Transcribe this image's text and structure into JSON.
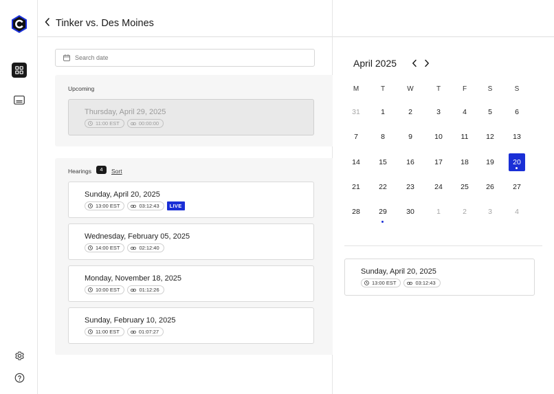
{
  "header": {
    "title": "Tinker vs. Des Moines"
  },
  "search": {
    "placeholder": "Search date"
  },
  "upcoming": {
    "label": "Upcoming",
    "card": {
      "date": "Thursday, April 29, 2025",
      "time": "11:00 EST",
      "duration": "00:00:00"
    }
  },
  "hearings": {
    "label": "Hearings",
    "count": "4",
    "sort_label": "Sort",
    "items": [
      {
        "date": "Sunday, April 20, 2025",
        "time": "13:00 EST",
        "duration": "03:12:43",
        "badge": "LIVE"
      },
      {
        "date": "Wednesday, February 05, 2025",
        "time": "14:00 EST",
        "duration": "02:12:40"
      },
      {
        "date": "Monday, November 18, 2025",
        "time": "10:00 EST",
        "duration": "01:12:26"
      },
      {
        "date": "Sunday, February 10, 2025",
        "time": "11:00 EST",
        "duration": "01:07:27"
      }
    ]
  },
  "calendar": {
    "month_label": "April 2025",
    "weekdays": [
      "M",
      "T",
      "W",
      "T",
      "F",
      "S",
      "S"
    ],
    "weeks": [
      [
        "31",
        "1",
        "2",
        "3",
        "4",
        "5",
        "6"
      ],
      [
        "7",
        "8",
        "9",
        "10",
        "11",
        "12",
        "13"
      ],
      [
        "14",
        "15",
        "16",
        "17",
        "18",
        "19",
        "20"
      ],
      [
        "21",
        "22",
        "23",
        "24",
        "25",
        "26",
        "27"
      ],
      [
        "28",
        "29",
        "30",
        "1",
        "2",
        "3",
        "4"
      ]
    ],
    "selected_day": "20",
    "dot_days": [
      "20",
      "29"
    ]
  },
  "selected_detail": {
    "date": "Sunday, April 20, 2025",
    "time": "13:00 EST",
    "duration": "03:12:43"
  },
  "colors": {
    "accent": "#1a2fd6",
    "logo": "#1a2fd6",
    "text": "#1a1a1a"
  },
  "icons": {
    "logo": "c-hexagon-logo",
    "nav": [
      "dashboard-grid-icon",
      "subtitles-icon"
    ],
    "footer": [
      "gear-icon",
      "help-circle-icon"
    ]
  }
}
